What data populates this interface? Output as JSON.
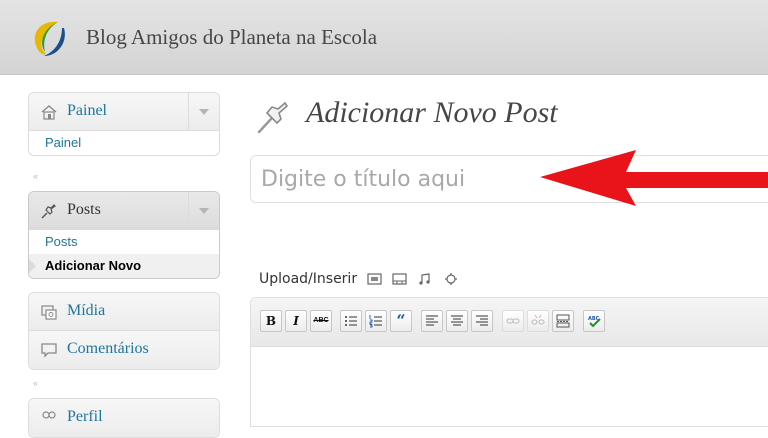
{
  "header": {
    "site_title": "Blog Amigos do Planeta na Escola"
  },
  "sidebar": {
    "painel": {
      "label": "Painel",
      "sub": [
        "Painel"
      ]
    },
    "posts": {
      "label": "Posts",
      "sub": [
        "Posts",
        "Adicionar Novo"
      ],
      "current": "Adicionar Novo"
    },
    "midia": {
      "label": "Mídia"
    },
    "comentarios": {
      "label": "Comentários"
    },
    "perfil": {
      "label": "Perfil"
    },
    "collapse_glyph": "«"
  },
  "main": {
    "page_title": "Adicionar Novo Post",
    "title_input": {
      "placeholder": "Digite o título aqui",
      "value": ""
    },
    "upload_label": "Upload/Inserir",
    "toolbar": {
      "bold": "B",
      "italic": "I",
      "strike": "ABC",
      "quote": "“"
    }
  },
  "colors": {
    "link": "#21759b",
    "arrow": "#e8141a"
  }
}
